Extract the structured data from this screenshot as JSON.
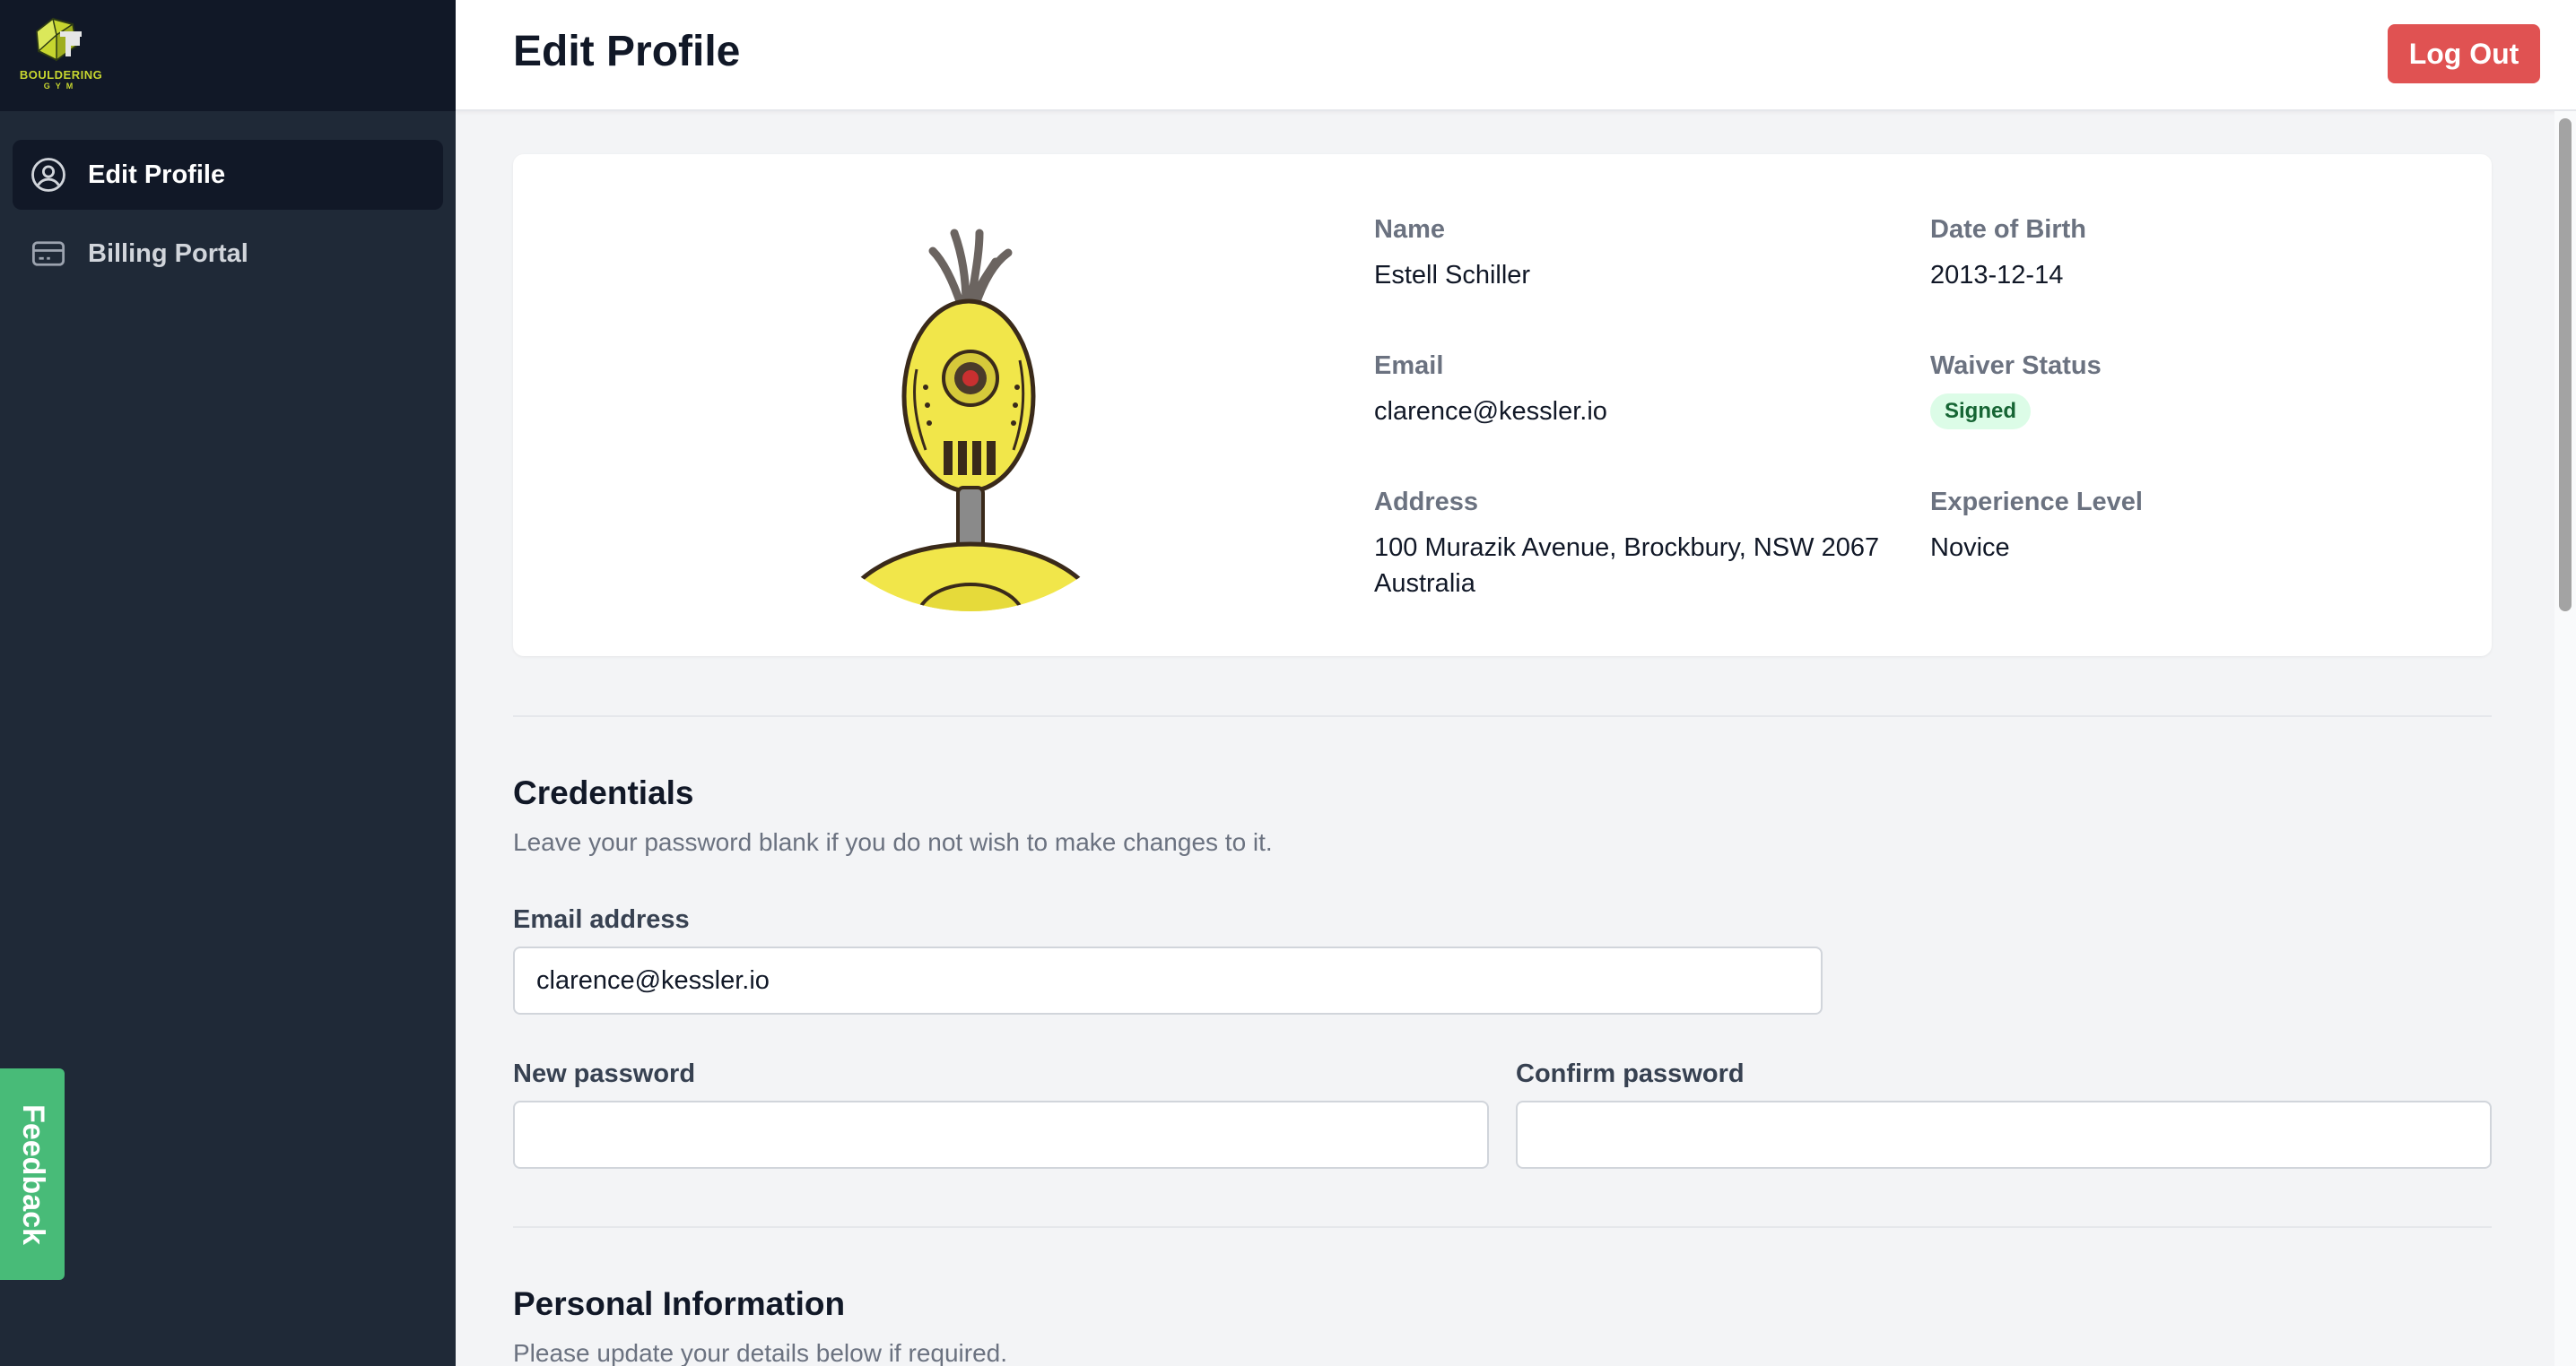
{
  "brand": {
    "line1": "BOULDERING",
    "line2": "GYM"
  },
  "sidebar": {
    "items": [
      {
        "label": "Edit Profile",
        "icon": "user-circle-icon",
        "active": true
      },
      {
        "label": "Billing Portal",
        "icon": "credit-card-icon",
        "active": false
      }
    ]
  },
  "feedback": {
    "label": "Feedback"
  },
  "header": {
    "title": "Edit Profile",
    "logout_label": "Log Out"
  },
  "profile": {
    "name_label": "Name",
    "name": "Estell Schiller",
    "dob_label": "Date of Birth",
    "dob": "2013-12-14",
    "email_label": "Email",
    "email": "clarence@kessler.io",
    "waiver_label": "Waiver Status",
    "waiver": "Signed",
    "address_label": "Address",
    "address_line1": "100 Murazik Avenue, Brockbury, NSW 2067",
    "address_line2": "Australia",
    "experience_label": "Experience Level",
    "experience": "Novice"
  },
  "credentials": {
    "title": "Credentials",
    "subtitle": "Leave your password blank if you do not wish to make changes to it.",
    "email_label": "Email address",
    "email_value": "clarence@kessler.io",
    "new_password_label": "New password",
    "new_password_value": "",
    "confirm_password_label": "Confirm password",
    "confirm_password_value": ""
  },
  "personal": {
    "title": "Personal Information",
    "subtitle": "Please update your details below if required."
  },
  "colors": {
    "sidebar_bg": "#1f2937",
    "sidebar_head_bg": "#111827",
    "logout_bg": "#e05252",
    "feedback_bg": "#48bb78",
    "badge_bg": "#dcfce7",
    "badge_text": "#166534",
    "brand_accent": "#c7d62f"
  }
}
